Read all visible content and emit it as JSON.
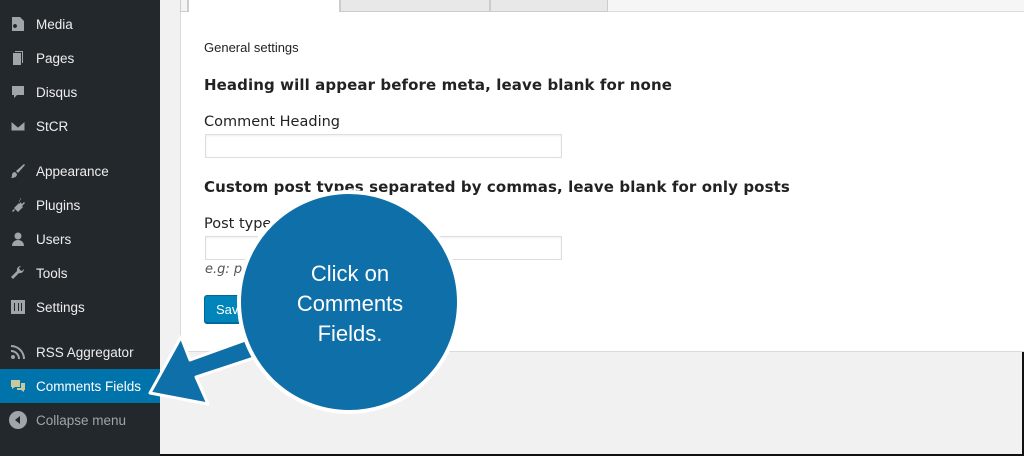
{
  "sidebar": {
    "items": [
      {
        "label": "Media",
        "icon": "media-icon"
      },
      {
        "label": "Pages",
        "icon": "pages-icon"
      },
      {
        "label": "Disqus",
        "icon": "comment-bubble-icon"
      },
      {
        "label": "StCR",
        "icon": "envelope-icon"
      },
      {
        "label": "Appearance",
        "icon": "paintbrush-icon"
      },
      {
        "label": "Plugins",
        "icon": "plug-icon"
      },
      {
        "label": "Users",
        "icon": "user-icon"
      },
      {
        "label": "Tools",
        "icon": "wrench-icon"
      },
      {
        "label": "Settings",
        "icon": "settings-sliders-icon"
      },
      {
        "label": "RSS Aggregator",
        "icon": "rss-icon"
      },
      {
        "label": "Comments Fields",
        "icon": "comments-fields-icon",
        "active": true
      }
    ],
    "collapse_label": "Collapse menu"
  },
  "main": {
    "section_title": "General settings",
    "heading_1": "Heading will appear before meta, leave blank for none",
    "field_1_label": "Comment Heading",
    "field_1_value": "",
    "heading_2": "Custom post types separated by commas, leave blank for only posts",
    "field_2_label": "Post types",
    "field_2_value": "",
    "hint": "e.g: po",
    "save_label": "Save"
  },
  "callout": {
    "line_1": "Click on",
    "line_2": "Comments",
    "line_3": "Fields."
  },
  "colors": {
    "sidebar_bg": "#23282d",
    "active_bg": "#0073aa",
    "callout_fill": "#0f6fa8",
    "button_bg": "#0085ba"
  }
}
